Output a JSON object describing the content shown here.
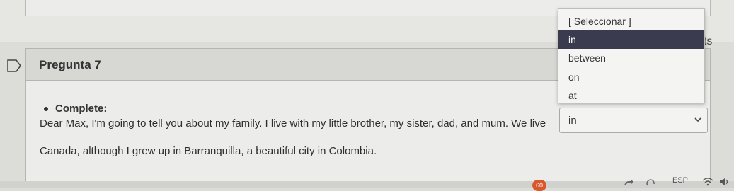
{
  "previous_question": {
    "points_partial": "ots"
  },
  "question": {
    "title": "Pregunta 7",
    "instruction": "Complete:",
    "text_line1": "Dear Max, I'm going to tell you about my family. I live with my little brother, my sister, dad, and mum. We live",
    "text_line2": "Canada, although I grew up in Barranquilla, a beautiful city in Colombia."
  },
  "answer_select": {
    "value": "in",
    "options": [
      "[ Seleccionar ]",
      "in",
      "between",
      "on",
      "at"
    ],
    "highlighted": "in"
  },
  "taskbar": {
    "badge": "60",
    "language": "ESP"
  },
  "icons": {
    "flag": "flag-icon",
    "chevron": "chevron-down-icon",
    "wifi": "wifi-icon",
    "volume": "volume-icon"
  }
}
